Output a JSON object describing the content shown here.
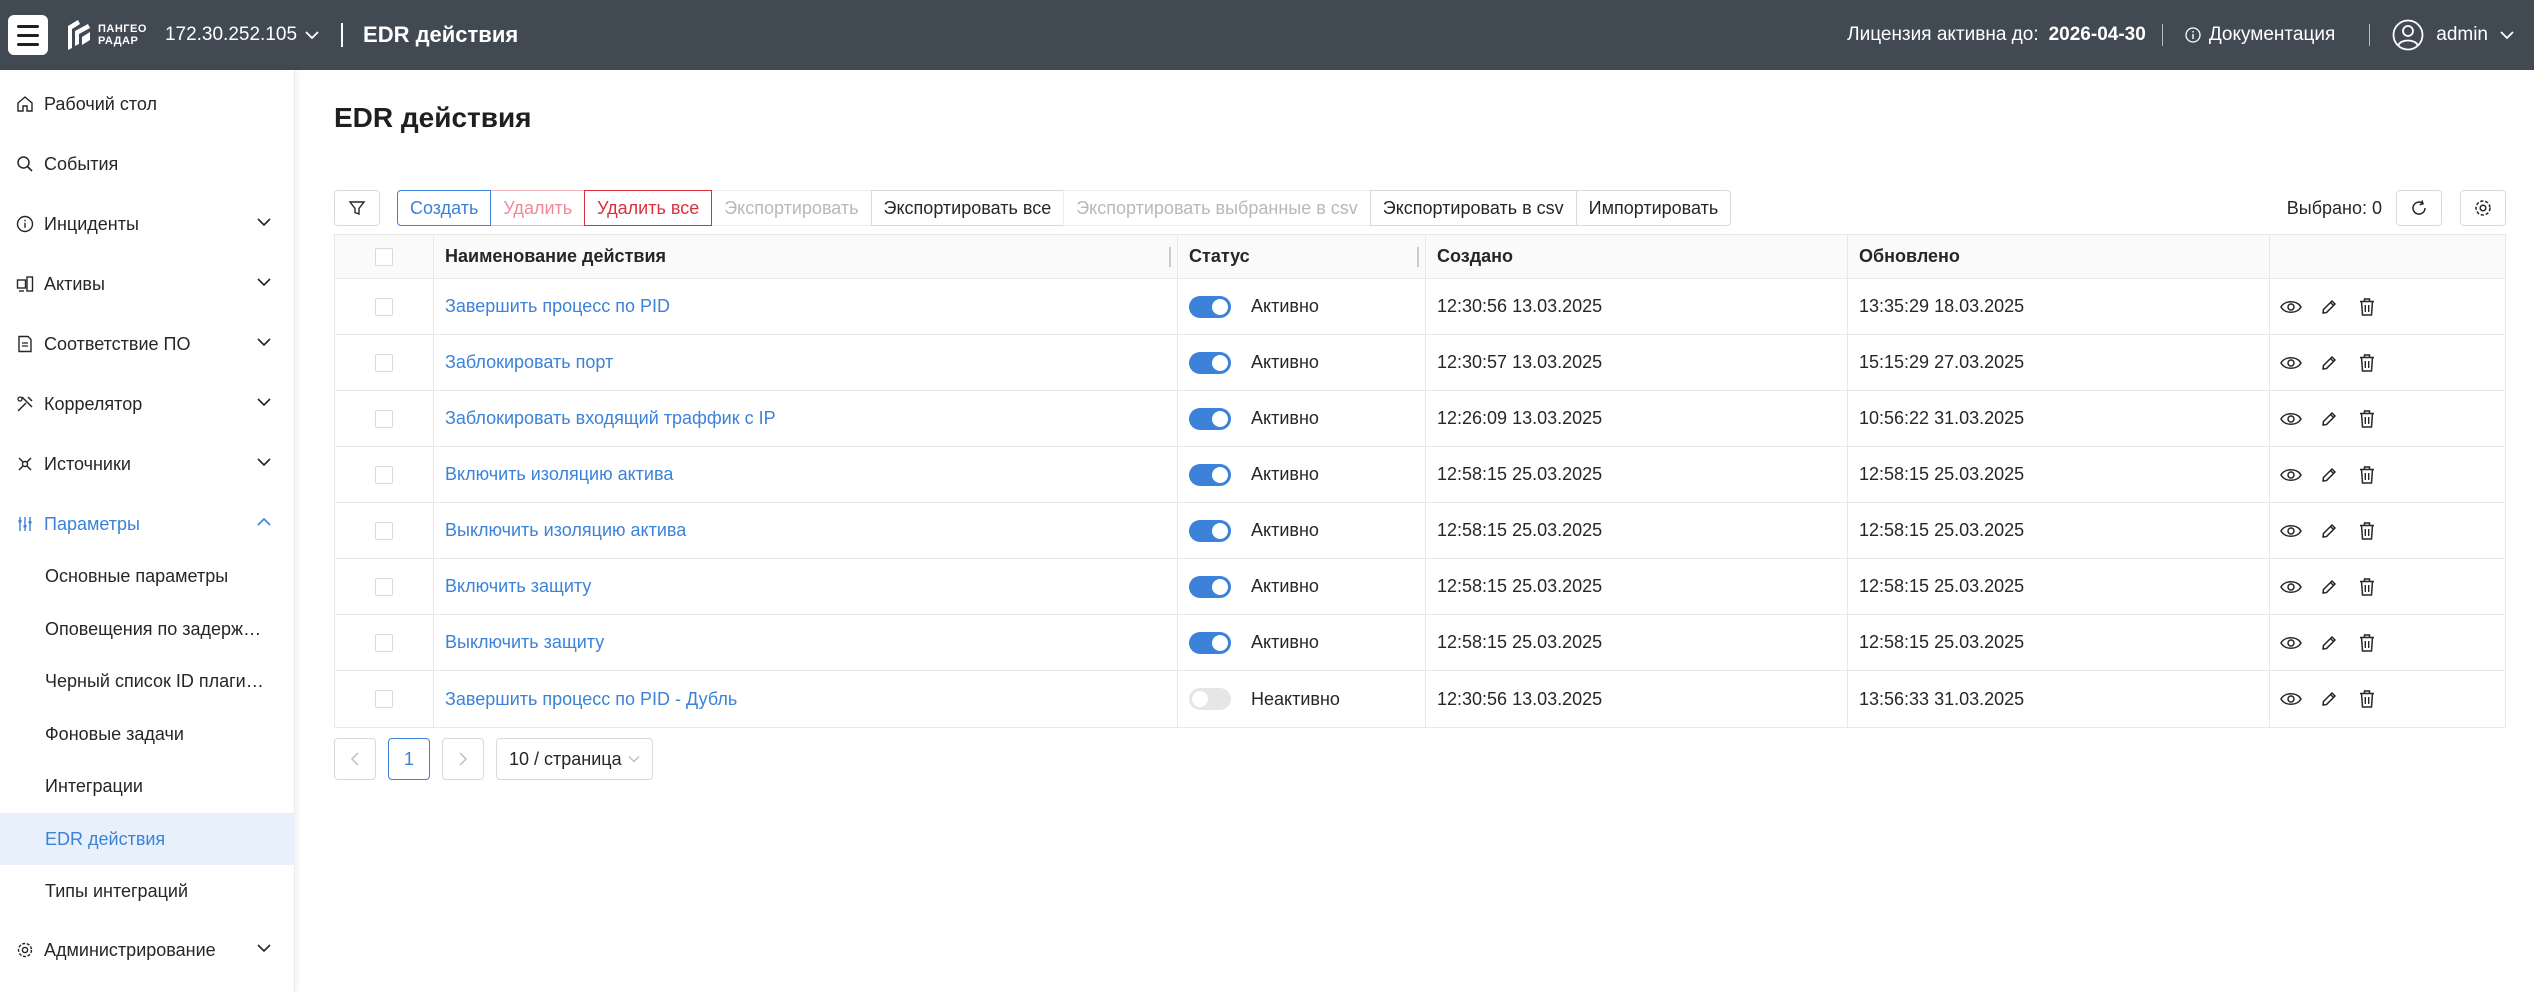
{
  "header": {
    "logo_line1": "ПАНГЕО",
    "logo_line2": "РАДАР",
    "host": "172.30.252.105",
    "title": "EDR действия",
    "license_label": "Лицензия активна до:",
    "license_date": "2026-04-30",
    "docs_label": "Документация",
    "user": "admin"
  },
  "sidebar": {
    "items": [
      {
        "label": "Рабочий стол",
        "icon": "home-icon"
      },
      {
        "label": "События",
        "icon": "search-icon"
      },
      {
        "label": "Инциденты",
        "icon": "info-icon"
      },
      {
        "label": "Активы",
        "icon": "devices-icon"
      },
      {
        "label": "Соответствие ПО",
        "icon": "document-icon"
      },
      {
        "label": "Коррелятор",
        "icon": "tools-icon"
      },
      {
        "label": "Источники",
        "icon": "sources-icon"
      },
      {
        "label": "Параметры",
        "icon": "sliders-icon"
      },
      {
        "label": "Администрирование",
        "icon": "gear-icon"
      }
    ],
    "sub_items": [
      "Основные параметры",
      "Оповещения по задерж…",
      "Черный список ID плаги…",
      "Фоновые задачи",
      "Интеграции",
      "EDR действия",
      "Типы интеграций"
    ],
    "selected_sub": "EDR действия"
  },
  "page": {
    "heading": "EDR действия"
  },
  "toolbar": {
    "create": "Создать",
    "delete": "Удалить",
    "delete_all": "Удалить все",
    "export": "Экспортировать",
    "export_all": "Экспортировать все",
    "export_selected_csv": "Экспортировать выбранные в csv",
    "export_csv": "Экспортировать в csv",
    "import": "Импортировать",
    "selected": "Выбрано: 0"
  },
  "table": {
    "columns": [
      "Наименование действия",
      "Статус",
      "Создано",
      "Обновлено"
    ],
    "rows": [
      {
        "name": "Завершить процесс по PID",
        "active": true,
        "status": "Активно",
        "created": "12:30:56 13.03.2025",
        "updated": "13:35:29 18.03.2025"
      },
      {
        "name": "Заблокировать порт",
        "active": true,
        "status": "Активно",
        "created": "12:30:57 13.03.2025",
        "updated": "15:15:29 27.03.2025"
      },
      {
        "name": "Заблокировать входящий траффик с IP",
        "active": true,
        "status": "Активно",
        "created": "12:26:09 13.03.2025",
        "updated": "10:56:22 31.03.2025"
      },
      {
        "name": "Включить изоляцию актива",
        "active": true,
        "status": "Активно",
        "created": "12:58:15 25.03.2025",
        "updated": "12:58:15 25.03.2025"
      },
      {
        "name": "Выключить изоляцию актива",
        "active": true,
        "status": "Активно",
        "created": "12:58:15 25.03.2025",
        "updated": "12:58:15 25.03.2025"
      },
      {
        "name": "Включить защиту",
        "active": true,
        "status": "Активно",
        "created": "12:58:15 25.03.2025",
        "updated": "12:58:15 25.03.2025"
      },
      {
        "name": "Выключить защиту",
        "active": true,
        "status": "Активно",
        "created": "12:58:15 25.03.2025",
        "updated": "12:58:15 25.03.2025"
      },
      {
        "name": "Завершить процесс по PID - Дубль",
        "active": false,
        "status": "Неактивно",
        "created": "12:30:56 13.03.2025",
        "updated": "13:56:33 31.03.2025"
      }
    ]
  },
  "pagination": {
    "current_page": "1",
    "page_size": "10 / страница"
  },
  "colors": {
    "topbar": "#414953",
    "accent": "#3b82d8",
    "danger": "#d9303e",
    "selected_bg": "#e8f0fc"
  }
}
